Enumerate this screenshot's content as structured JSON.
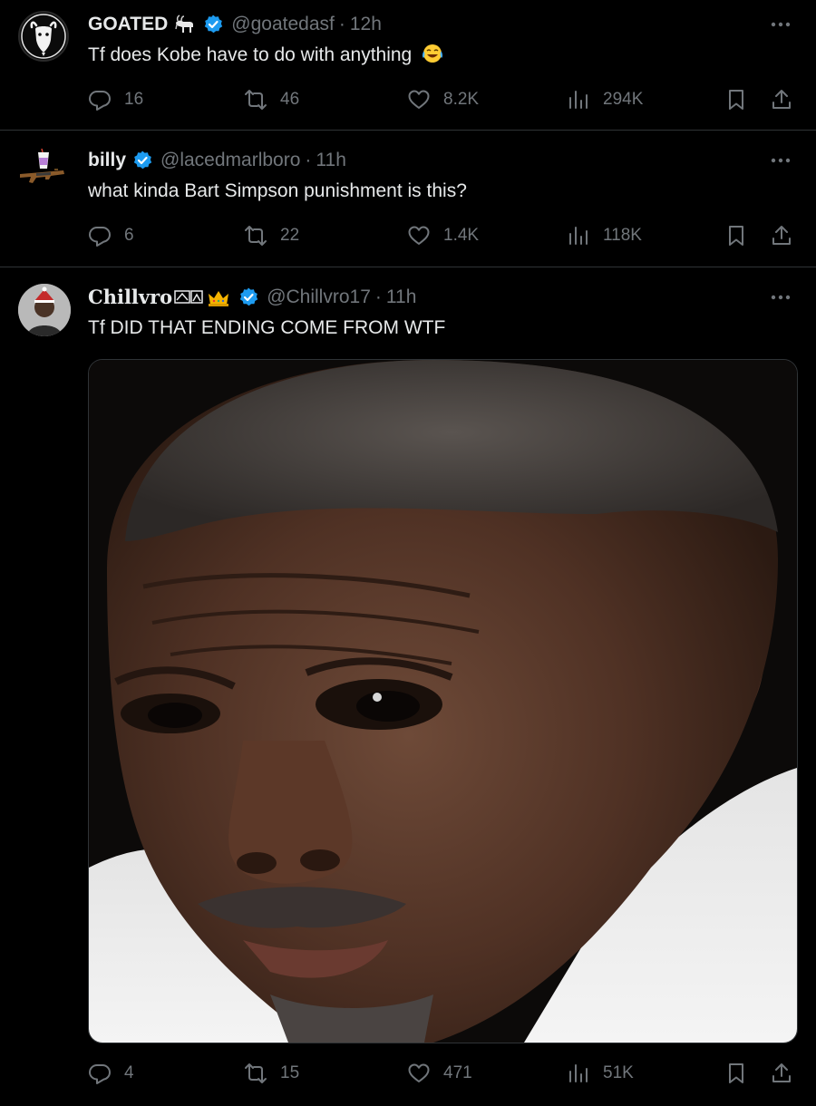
{
  "tweets": [
    {
      "name": "GOATED",
      "name_emoji": "goat-emoji",
      "handle": "@goatedasf",
      "separator": "·",
      "time": "12h",
      "text": "Tf does Kobe have to do with anything",
      "text_emoji": "tears-of-joy-emoji",
      "replies": "16",
      "reposts": "46",
      "likes": "8.2K",
      "views": "294K"
    },
    {
      "name": "billy",
      "handle": "@lacedmarlboro",
      "separator": "·",
      "time": "11h",
      "text": "what kinda Bart Simpson punishment is this?",
      "replies": "6",
      "reposts": "22",
      "likes": "1.4K",
      "views": "118K"
    },
    {
      "name": "Chillvro",
      "name_emoji": "goat-crown-emoji",
      "handle": "@Chillvro17",
      "separator": "·",
      "time": "11h",
      "text": "Tf DID THAT ENDING COME FROM WTF",
      "media": "photo-closeup-face",
      "replies": "4",
      "reposts": "15",
      "likes": "471",
      "views": "51K"
    }
  ],
  "icons": {
    "reply": "reply-icon",
    "repost": "repost-icon",
    "like": "heart-icon",
    "views": "views-icon",
    "bookmark": "bookmark-icon",
    "share": "share-icon",
    "more": "more-icon",
    "verified": "verified-icon"
  },
  "colors": {
    "background": "#000000",
    "text": "#e7e9ea",
    "muted": "#71767b",
    "verified": "#1d9bf0",
    "divider": "#2f3336"
  }
}
